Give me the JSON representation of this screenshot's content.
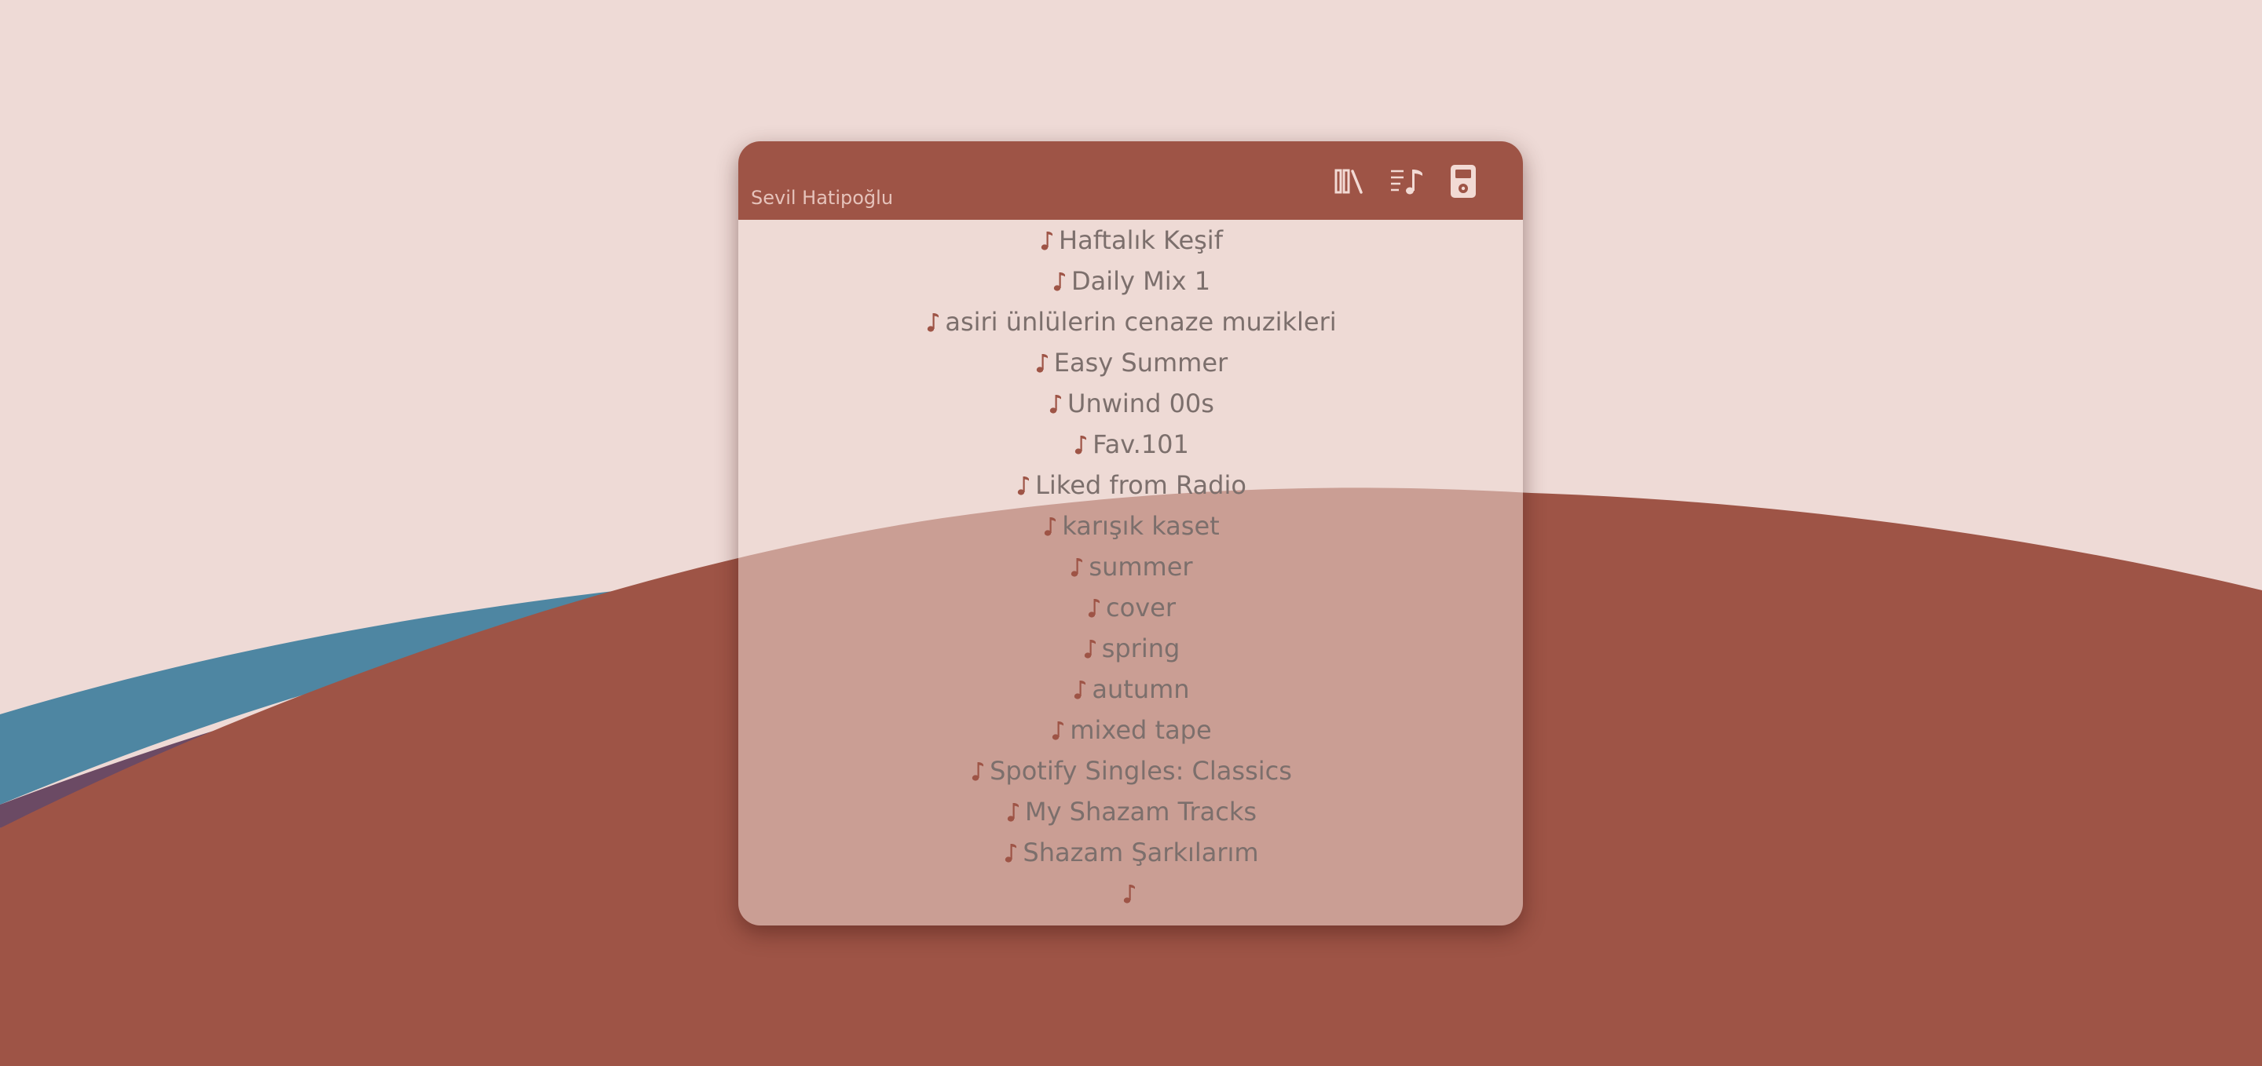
{
  "app": {
    "user_name": "Sevil Hatipoğlu"
  },
  "colors": {
    "background": "#eedad6",
    "accent": "#9e5446",
    "wave_blue": "#4e86a2",
    "wave_purple": "#6b4a64",
    "text": "#7c6f6c",
    "header_text": "#e6c3bb",
    "toolbar_icon": "#f2dad4"
  },
  "toolbar": {
    "icons": [
      "library-icon",
      "queue-music-icon",
      "device-icon"
    ]
  },
  "playlists": [
    {
      "name": "Haftalık Keşif",
      "icon": "music-note-icon"
    },
    {
      "name": "Daily Mix 1",
      "icon": "music-note-icon"
    },
    {
      "name": "asiri ünlülerin cenaze muzikleri",
      "icon": "music-note-icon"
    },
    {
      "name": "Easy Summer",
      "icon": "music-note-icon"
    },
    {
      "name": "Unwind 00s",
      "icon": "music-note-icon"
    },
    {
      "name": "Fav.101",
      "icon": "music-note-icon"
    },
    {
      "name": "Liked from Radio",
      "icon": "music-note-icon"
    },
    {
      "name": "karışık kaset",
      "icon": "music-note-icon"
    },
    {
      "name": "summer",
      "icon": "music-note-icon"
    },
    {
      "name": "cover",
      "icon": "music-note-icon"
    },
    {
      "name": "spring",
      "icon": "music-note-icon"
    },
    {
      "name": "autumn",
      "icon": "music-note-icon"
    },
    {
      "name": "mixed tape",
      "icon": "music-note-icon"
    },
    {
      "name": "Spotify Singles: Classics",
      "icon": "music-note-icon"
    },
    {
      "name": "My Shazam Tracks",
      "icon": "music-note-icon"
    },
    {
      "name": "Shazam Şarkılarım",
      "icon": "music-note-icon"
    },
    {
      "name": "",
      "icon": "music-note-icon"
    }
  ]
}
